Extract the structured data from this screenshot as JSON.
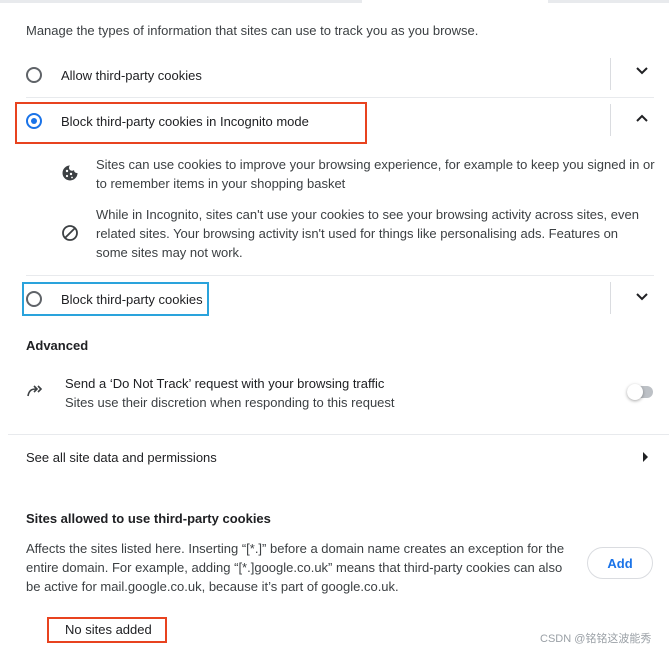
{
  "description": "Manage the types of information that sites can use to track you as you browse.",
  "options": [
    {
      "label": "Allow third-party cookies",
      "selected": false
    },
    {
      "label": "Block third-party cookies in Incognito mode",
      "selected": true
    },
    {
      "label": "Block third-party cookies",
      "selected": false
    }
  ],
  "incognito_details": {
    "cookie_text": "Sites can use cookies to improve your browsing experience, for example to keep you signed in or to remember items in your shopping basket",
    "block_text": "While in Incognito, sites can't use your cookies to see your browsing activity across sites, even related sites. Your browsing activity isn't used for things like personalising ads. Features on some sites may not work."
  },
  "advanced": {
    "heading": "Advanced",
    "dnt_title": "Send a ‘Do Not Track’ request with your browsing traffic",
    "dnt_subtitle": "Sites use their discretion when responding to this request",
    "dnt_enabled": false
  },
  "see_all": "See all site data and permissions",
  "allowed_sites": {
    "heading": "Sites allowed to use third-party cookies",
    "description": "Affects the sites listed here. Inserting “[*.]” before a domain name creates an exception for the entire domain. For example, adding “[*.]google.co.uk” means that third-party cookies can also be active for mail.google.co.uk, because it’s part of google.co.uk.",
    "add_label": "Add",
    "empty_text": "No sites added"
  },
  "watermark": "CSDN @铭铭这波能秀",
  "colors": {
    "accent": "#1a73e8",
    "highlight_red": "#e8431f",
    "highlight_blue": "#2aa3dc"
  }
}
